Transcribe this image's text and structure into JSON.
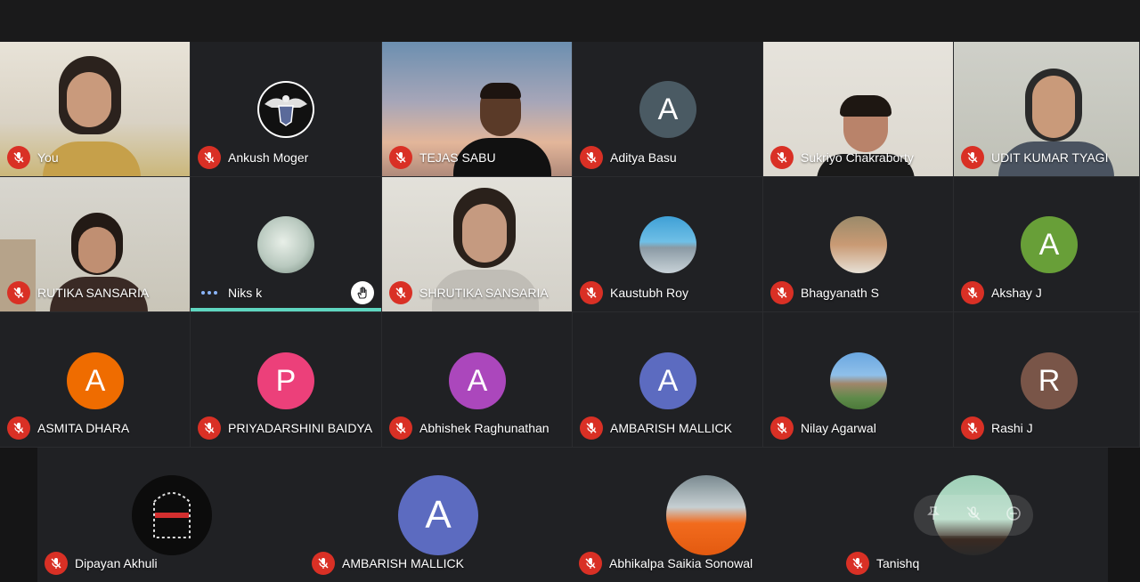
{
  "colors": {
    "background": "#202124",
    "mic_muted": "#d93025",
    "speaking_bar": "#5fd6c0"
  },
  "grid": [
    {
      "name": "You",
      "type": "video"
    },
    {
      "name": "Ankush Moger",
      "type": "photo",
      "icon": "eagle-emblem-icon"
    },
    {
      "name": "TEJAS SABU",
      "type": "video"
    },
    {
      "name": "Aditya Basu",
      "type": "initial",
      "initial": "A",
      "color": "#4a5a63"
    },
    {
      "name": "Sukriyo Chakraborty",
      "type": "video"
    },
    {
      "name": "UDIT KUMAR TYAGI",
      "type": "video"
    },
    {
      "name": "RUTIKA SANSARIA",
      "type": "video"
    },
    {
      "name": "Niks k",
      "type": "photo",
      "speaking": true,
      "hand_raised": true
    },
    {
      "name": "SHRUTIKA SANSARIA",
      "type": "video"
    },
    {
      "name": "Kaustubh Roy",
      "type": "photo"
    },
    {
      "name": "Bhagyanath S",
      "type": "photo"
    },
    {
      "name": "Akshay J",
      "type": "initial",
      "initial": "A",
      "color": "#689f38"
    },
    {
      "name": "ASMITA DHARA",
      "type": "initial",
      "initial": "A",
      "color": "#ef6c00"
    },
    {
      "name": "PRIYADARSHINI BAIDYA",
      "type": "initial",
      "initial": "P",
      "color": "#ec407a"
    },
    {
      "name": "Abhishek Raghunathan",
      "type": "initial",
      "initial": "A",
      "color": "#ab47bc"
    },
    {
      "name": "AMBARISH MALLICK",
      "type": "initial",
      "initial": "A",
      "color": "#5c6bc0"
    },
    {
      "name": "Nilay Agarwal",
      "type": "photo"
    },
    {
      "name": "Rashi J",
      "type": "initial",
      "initial": "R",
      "color": "#795548"
    }
  ],
  "bottom_row": [
    {
      "name": "Dipayan Akhuli",
      "type": "photo"
    },
    {
      "name": "AMBARISH MALLICK",
      "type": "initial",
      "initial": "A",
      "color": "#5c6bc0"
    },
    {
      "name": "Abhikalpa Saikia Sonowal",
      "type": "photo"
    },
    {
      "name": "Tanishq",
      "type": "photo",
      "hovered": true
    }
  ]
}
